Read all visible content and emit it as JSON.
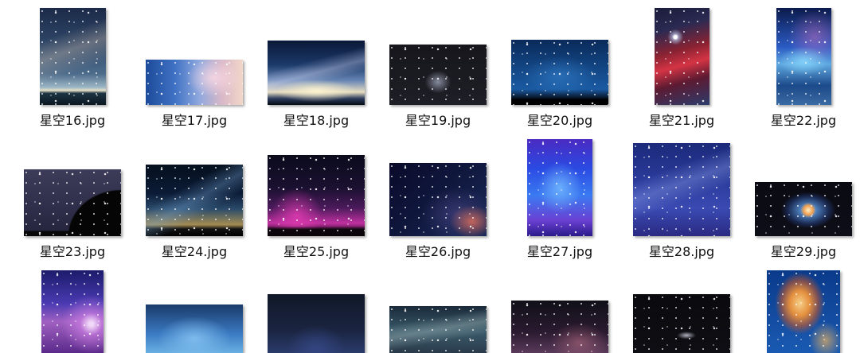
{
  "files": [
    {
      "name": "星空16.jpg"
    },
    {
      "name": "星空17.jpg"
    },
    {
      "name": "星空18.jpg"
    },
    {
      "name": "星空19.jpg"
    },
    {
      "name": "星空20.jpg"
    },
    {
      "name": "星空21.jpg"
    },
    {
      "name": "星空22.jpg"
    },
    {
      "name": "星空23.jpg"
    },
    {
      "name": "星空24.jpg"
    },
    {
      "name": "星空25.jpg"
    },
    {
      "name": "星空26.jpg"
    },
    {
      "name": "星空27.jpg"
    },
    {
      "name": "星空28.jpg"
    },
    {
      "name": "星空29.jpg"
    }
  ]
}
